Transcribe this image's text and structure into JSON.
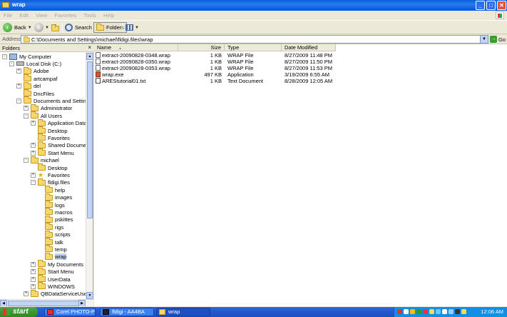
{
  "window": {
    "title": "wrap",
    "buttons": {
      "minimize": "_",
      "maximize": "□",
      "close": "✕"
    }
  },
  "menu": [
    "File",
    "Edit",
    "View",
    "Favorites",
    "Tools",
    "Help"
  ],
  "toolbar": {
    "back": "Back",
    "search": "Search",
    "folders": "Folders"
  },
  "address": {
    "label": "Address",
    "value": "C:\\Documents and Settings\\michael\\fldigi.files\\wrap",
    "go": "Go"
  },
  "folders_pane": {
    "title": "Folders",
    "close": "×",
    "tree": [
      {
        "label": "My Computer",
        "level": 0,
        "toggle": "-",
        "icon": "computer"
      },
      {
        "label": "Local Disk (C:)",
        "level": 1,
        "toggle": "-",
        "icon": "disk"
      },
      {
        "label": "Adobe",
        "level": 2,
        "toggle": "+",
        "icon": "folder"
      },
      {
        "label": "artcampaf",
        "level": 2,
        "toggle": "",
        "icon": "folder"
      },
      {
        "label": "del",
        "level": 2,
        "toggle": "+",
        "icon": "folder"
      },
      {
        "label": "DncFiles",
        "level": 2,
        "toggle": "",
        "icon": "folder"
      },
      {
        "label": "Documents and Setting",
        "level": 2,
        "toggle": "-",
        "icon": "folder"
      },
      {
        "label": "Administrator",
        "level": 3,
        "toggle": "+",
        "icon": "folder"
      },
      {
        "label": "All Users",
        "level": 3,
        "toggle": "-",
        "icon": "folder"
      },
      {
        "label": "Application Data",
        "level": 4,
        "toggle": "+",
        "icon": "folder"
      },
      {
        "label": "Desktop",
        "level": 4,
        "toggle": "",
        "icon": "folder"
      },
      {
        "label": "Favorites",
        "level": 4,
        "toggle": "",
        "icon": "folder"
      },
      {
        "label": "Shared Docume",
        "level": 4,
        "toggle": "+",
        "icon": "folder"
      },
      {
        "label": "Start Menu",
        "level": 4,
        "toggle": "+",
        "icon": "folder"
      },
      {
        "label": "michael",
        "level": 3,
        "toggle": "-",
        "icon": "folder"
      },
      {
        "label": "Desktop",
        "level": 4,
        "toggle": "",
        "icon": "folder"
      },
      {
        "label": "Favorites",
        "level": 4,
        "toggle": "+",
        "icon": "star"
      },
      {
        "label": "fldigi.files",
        "level": 4,
        "toggle": "-",
        "icon": "folder"
      },
      {
        "label": "help",
        "level": 5,
        "toggle": "",
        "icon": "folder"
      },
      {
        "label": "images",
        "level": 5,
        "toggle": "",
        "icon": "folder"
      },
      {
        "label": "logs",
        "level": 5,
        "toggle": "",
        "icon": "folder"
      },
      {
        "label": "macros",
        "level": 5,
        "toggle": "",
        "icon": "folder"
      },
      {
        "label": "pskittes",
        "level": 5,
        "toggle": "",
        "icon": "folder"
      },
      {
        "label": "rigs",
        "level": 5,
        "toggle": "",
        "icon": "folder"
      },
      {
        "label": "scripts",
        "level": 5,
        "toggle": "",
        "icon": "folder"
      },
      {
        "label": "talk",
        "level": 5,
        "toggle": "",
        "icon": "folder"
      },
      {
        "label": "temp",
        "level": 5,
        "toggle": "",
        "icon": "folder"
      },
      {
        "label": "wrap",
        "level": 5,
        "toggle": "",
        "icon": "folder",
        "selected": true
      },
      {
        "label": "My Documents",
        "level": 4,
        "toggle": "+",
        "icon": "folder"
      },
      {
        "label": "Start Menu",
        "level": 4,
        "toggle": "+",
        "icon": "folder"
      },
      {
        "label": "UserData",
        "level": 4,
        "toggle": "+",
        "icon": "folder"
      },
      {
        "label": "WINDOWS",
        "level": 4,
        "toggle": "+",
        "icon": "folder"
      },
      {
        "label": "QBDataServiceUser",
        "level": 3,
        "toggle": "+",
        "icon": "folder"
      }
    ]
  },
  "file_list": {
    "columns": {
      "name": "Name",
      "sort_arrow": "▲",
      "size": "Size",
      "type": "Type",
      "modified": "Date Modified"
    },
    "rows": [
      {
        "name": "extract-20090828-0348.wrap",
        "size": "1 KB",
        "type": "WRAP File",
        "modified": "8/27/2009 11:48 PM",
        "icon": "file"
      },
      {
        "name": "extract-20090828-0350.wrap",
        "size": "1 KB",
        "type": "WRAP File",
        "modified": "8/27/2009 11:50 PM",
        "icon": "file"
      },
      {
        "name": "extract-20090828-0353.wrap",
        "size": "1 KB",
        "type": "WRAP File",
        "modified": "8/27/2009 11:53 PM",
        "icon": "file"
      },
      {
        "name": "wrap.exe",
        "size": "497 KB",
        "type": "Application",
        "modified": "3/19/2009 6:55 AM",
        "icon": "exe"
      },
      {
        "name": "AREStutorial01.txt",
        "size": "1 KB",
        "type": "Text Document",
        "modified": "8/28/2009 12:05 AM",
        "icon": "txt"
      }
    ]
  },
  "taskbar": {
    "start": "start",
    "tasks": [
      {
        "label": "Corel PHOTO-P...",
        "icon": "corel"
      },
      {
        "label": "fldigi - AA4BA",
        "icon": "fldigi"
      },
      {
        "label": "wrap",
        "icon": "folder",
        "active": true
      }
    ],
    "clock": "12:06 AM"
  }
}
